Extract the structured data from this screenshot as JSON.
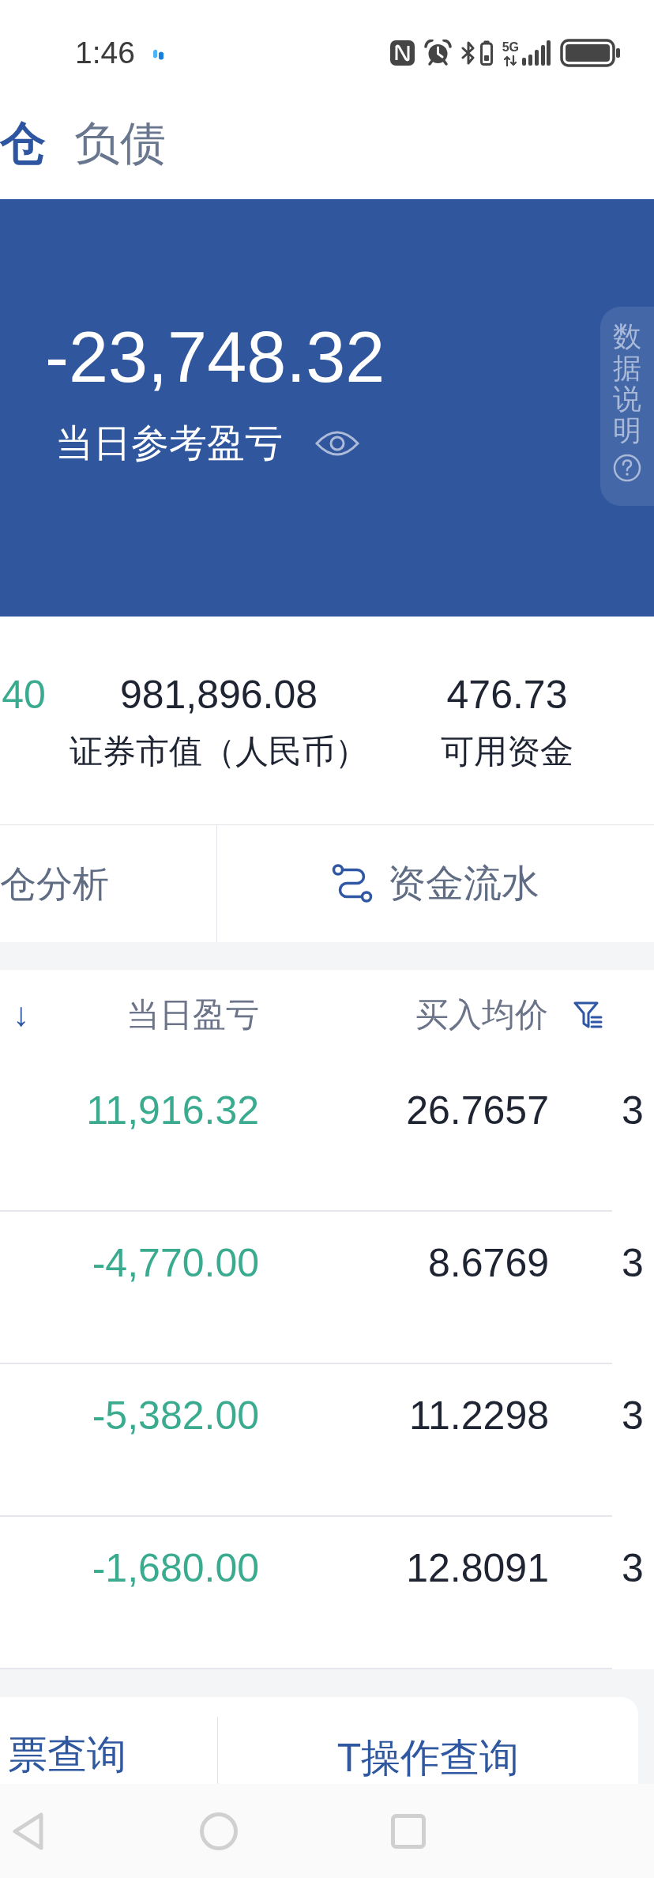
{
  "status_bar": {
    "time": "1:46",
    "network_type": "5G"
  },
  "header": {
    "tabs": [
      {
        "label": "仓",
        "selected": true
      },
      {
        "label": "负债",
        "selected": false
      }
    ]
  },
  "summary": {
    "value": "-23,748.32",
    "label": "当日参考盈亏",
    "info_button": "数据说明"
  },
  "stats": [
    {
      "value": "40",
      "kind": "loss"
    },
    {
      "value": "981,896.08",
      "label": "证券市值（人民币）",
      "kind": "neutral"
    },
    {
      "value": "476.73",
      "label": "可用资金",
      "kind": "neutral"
    }
  ],
  "shortcuts": [
    {
      "label": "仓分析",
      "kind": "plain"
    },
    {
      "label": "资金流水",
      "kind": "iconed"
    }
  ],
  "holdings": {
    "columns": [
      {
        "label": "↓",
        "kind": "sort"
      },
      {
        "label": "当日盈亏",
        "kind": "plain"
      },
      {
        "label": "买入均价",
        "kind": "filter"
      }
    ],
    "rows": [
      {
        "day_pnl": "11,916.32",
        "kind": "loss",
        "buy_avg_price": "26.7657",
        "column_4": "3"
      },
      {
        "day_pnl": "-4,770.00",
        "kind": "loss",
        "buy_avg_price": "8.6769",
        "column_4": "3"
      },
      {
        "day_pnl": "-5,382.00",
        "kind": "loss",
        "buy_avg_price": "11.2298",
        "column_4": "3"
      },
      {
        "day_pnl": "-1,680.00",
        "kind": "loss",
        "buy_avg_price": "12.8091",
        "column_4": "3"
      }
    ]
  },
  "queries": [
    {
      "label": "票查询"
    },
    {
      "label": "T操作查询"
    }
  ]
}
